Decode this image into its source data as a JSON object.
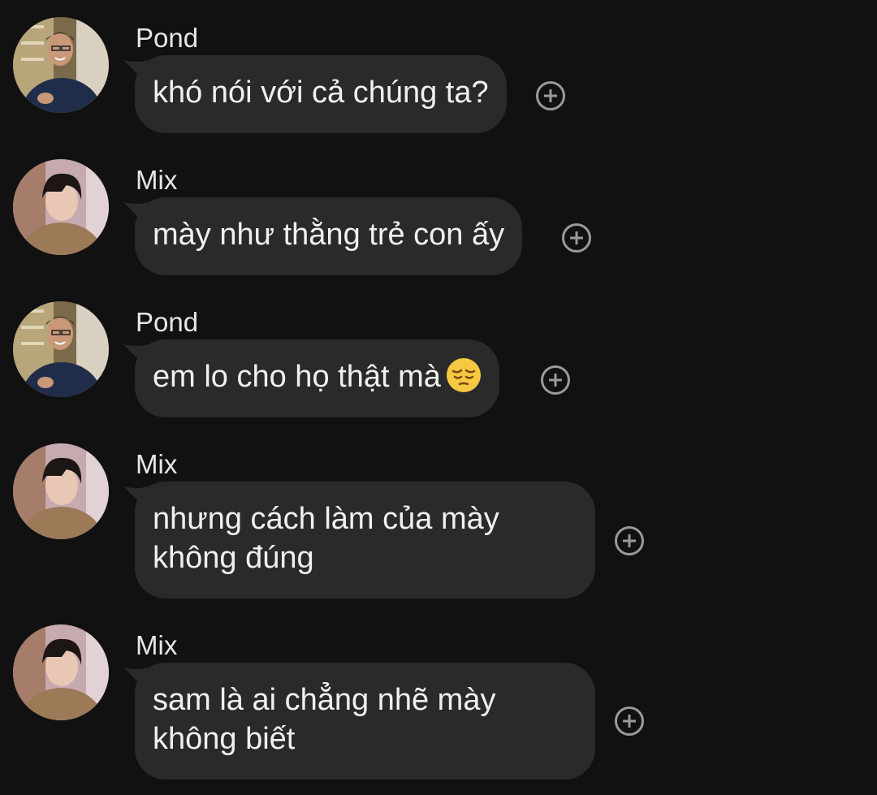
{
  "messages": [
    {
      "sender": "Pond",
      "avatar": "pond",
      "text": "khó nói với cả chúng ta?",
      "emoji": null
    },
    {
      "sender": "Mix",
      "avatar": "mix",
      "text": "mày như thằng trẻ con ấy",
      "emoji": null
    },
    {
      "sender": "Pond",
      "avatar": "pond",
      "text": "em lo cho họ thật mà",
      "emoji": "pensive-face-emoji"
    },
    {
      "sender": "Mix",
      "avatar": "mix",
      "text": "nhưng cách làm của mày\nkhông đúng",
      "emoji": null
    },
    {
      "sender": "Mix",
      "avatar": "mix",
      "text": "sam là ai chẳng nhẽ mày\nkhông biết",
      "emoji": null
    }
  ],
  "icons": {
    "reaction": "add-reaction-icon"
  },
  "colors": {
    "background": "#111111",
    "bubble": "#2a2a2a",
    "text": "#f0f0f0",
    "icon": "#9a9a9a"
  }
}
